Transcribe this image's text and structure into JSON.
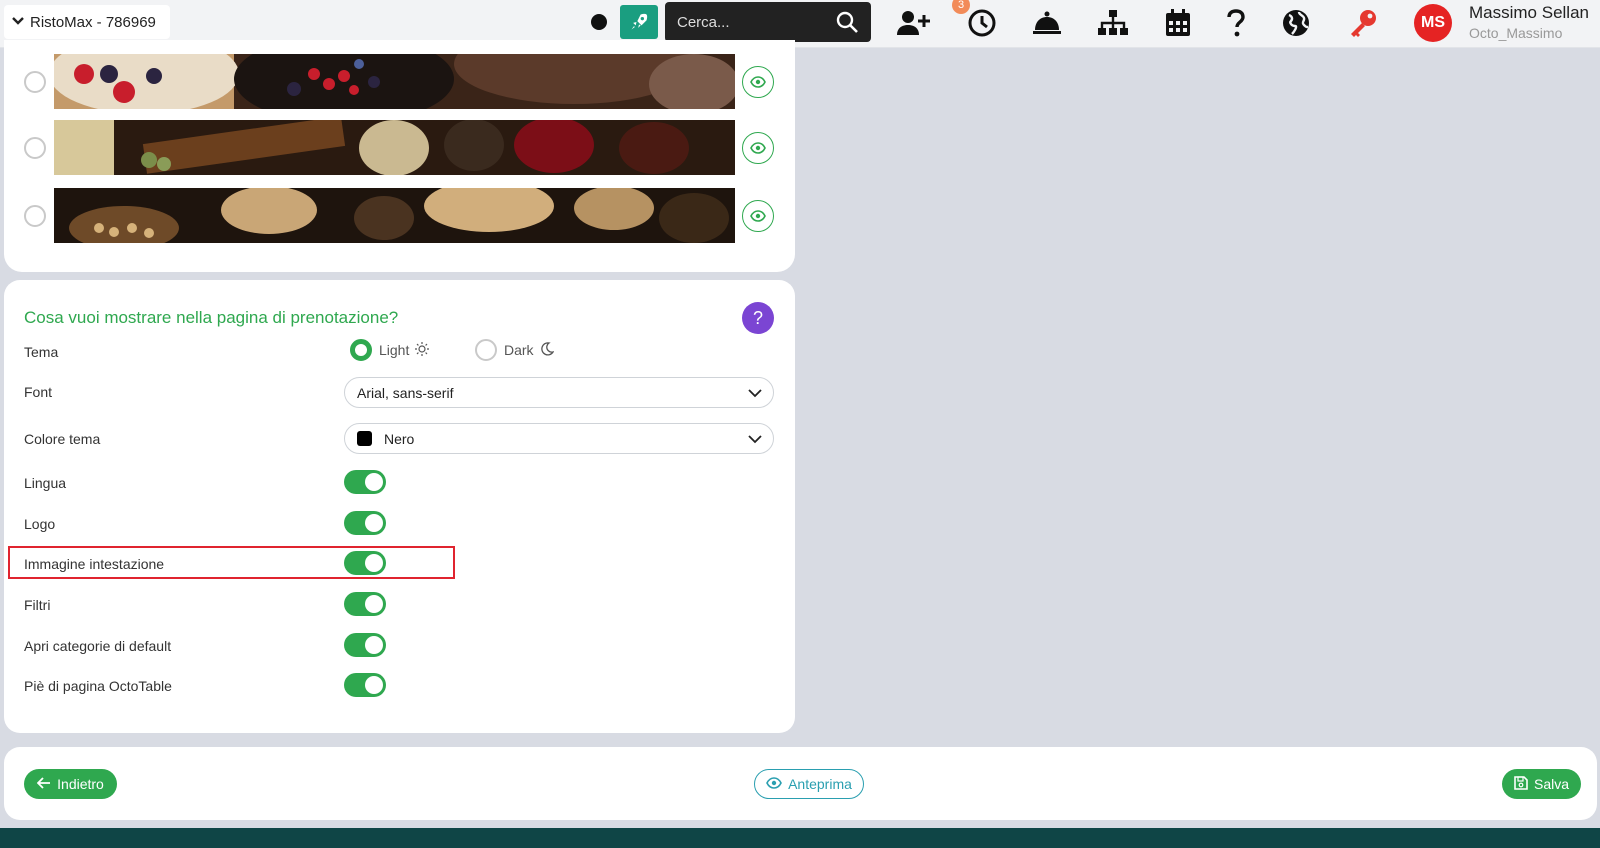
{
  "header": {
    "venue": "RistoMax - 786969",
    "search_placeholder": "Cerca...",
    "notifications_count": "3",
    "user_initials": "MS",
    "user_name": "Massimo Sellan",
    "user_handle": "Octo_Massimo",
    "icons": [
      "rocket-icon",
      "search-icon",
      "add-user-icon",
      "clock-icon",
      "service-bell-icon",
      "sitemap-icon",
      "calendar-icon",
      "help-icon",
      "globe-icon",
      "key-icon"
    ]
  },
  "images": [
    {
      "name": "dessert-berries",
      "selected": false
    },
    {
      "name": "wine-cheese",
      "selected": false
    },
    {
      "name": "beer-nuts",
      "selected": false
    }
  ],
  "settings": {
    "title": "Cosa vuoi mostrare nella pagina di prenotazione?",
    "help_label": "?",
    "theme_label": "Tema",
    "theme_light": "Light",
    "theme_dark": "Dark",
    "theme_selected": "Light",
    "font_label": "Font",
    "font_value": "Arial, sans-serif",
    "color_label": "Colore tema",
    "color_value": "Nero",
    "color_swatch": "#000000",
    "toggles": [
      {
        "label": "Lingua",
        "on": true
      },
      {
        "label": "Logo",
        "on": true
      },
      {
        "label": "Immagine intestazione",
        "on": true
      },
      {
        "label": "Filtri",
        "on": true
      },
      {
        "label": "Apri categorie di default",
        "on": true
      },
      {
        "label": "Piè di pagina OctoTable",
        "on": true
      }
    ]
  },
  "actions": {
    "back": "Indietro",
    "preview": "Anteprima",
    "save": "Salva"
  },
  "colors": {
    "accent_green": "#2fa84f",
    "teal": "#1a9e80",
    "purple": "#7b45d3",
    "highlight_red": "#e0242f",
    "avatar_red": "#e52323"
  }
}
